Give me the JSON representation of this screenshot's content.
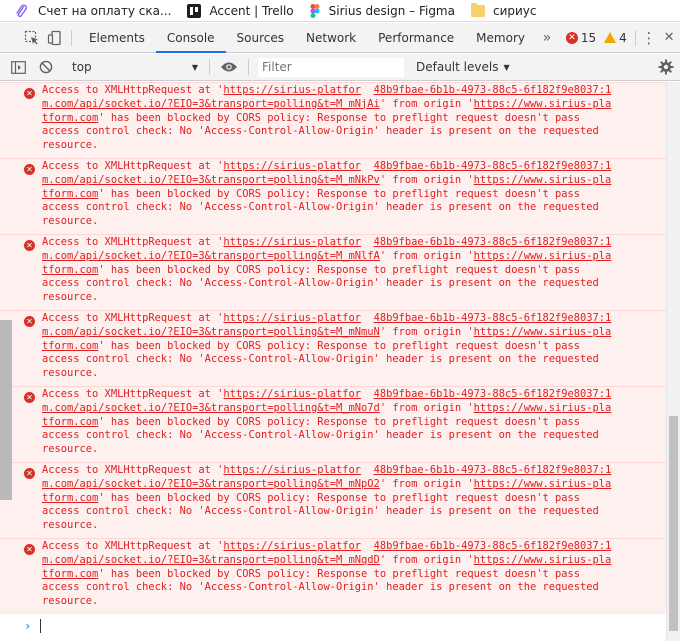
{
  "bookmarks": [
    {
      "label": "Счет на оплату ска...",
      "icon": "paperclip-icon"
    },
    {
      "label": "Accent | Trello",
      "icon": "trello-icon"
    },
    {
      "label": "Sirius design – Figma",
      "icon": "figma-icon"
    },
    {
      "label": "сириус",
      "icon": "folder-icon"
    }
  ],
  "devtools": {
    "tabs": [
      "Elements",
      "Console",
      "Sources",
      "Network",
      "Performance",
      "Memory"
    ],
    "active_tab": "Console",
    "more_label": "»",
    "errors_count": "15",
    "warnings_count": "4",
    "kebab_label": "⋮",
    "close_label": "✕"
  },
  "console_toolbar": {
    "context": "top",
    "filter_placeholder": "Filter",
    "levels_label": "Default levels"
  },
  "colors": {
    "error_text": "#e02020",
    "error_bg": "#fff0f0",
    "accent": "#1a73e8",
    "warning": "#f2a600"
  },
  "messages": [
    {
      "url_start": "https://sirius-platfor",
      "source": "48b9fbae-6b1b-4973-88c5-6f182f9e8037:1",
      "url_mid": "m.com/api/socket.io/?EIO=3&transport=polling&t=M_mNjAi",
      "origin_start": "https://www.sirius-pla",
      "origin_end": "tform.com"
    },
    {
      "url_start": "https://sirius-platfor",
      "source": "48b9fbae-6b1b-4973-88c5-6f182f9e8037:1",
      "url_mid": "m.com/api/socket.io/?EIO=3&transport=polling&t=M_mNkPv",
      "origin_start": "https://www.sirius-pla",
      "origin_end": "tform.com"
    },
    {
      "url_start": "https://sirius-platfor",
      "source": "48b9fbae-6b1b-4973-88c5-6f182f9e8037:1",
      "url_mid": "m.com/api/socket.io/?EIO=3&transport=polling&t=M_mNlfA",
      "origin_start": "https://www.sirius-pla",
      "origin_end": "tform.com"
    },
    {
      "url_start": "https://sirius-platfor",
      "source": "48b9fbae-6b1b-4973-88c5-6f182f9e8037:1",
      "url_mid": "m.com/api/socket.io/?EIO=3&transport=polling&t=M_mNmuN",
      "origin_start": "https://www.sirius-pla",
      "origin_end": "tform.com"
    },
    {
      "url_start": "https://sirius-platfor",
      "source": "48b9fbae-6b1b-4973-88c5-6f182f9e8037:1",
      "url_mid": "m.com/api/socket.io/?EIO=3&transport=polling&t=M_mNo7d",
      "origin_start": "https://www.sirius-pla",
      "origin_end": "tform.com"
    },
    {
      "url_start": "https://sirius-platfor",
      "source": "48b9fbae-6b1b-4973-88c5-6f182f9e8037:1",
      "url_mid": "m.com/api/socket.io/?EIO=3&transport=polling&t=M_mNpO2",
      "origin_start": "https://www.sirius-pla",
      "origin_end": "tform.com"
    },
    {
      "url_start": "https://sirius-platfor",
      "source": "48b9fbae-6b1b-4973-88c5-6f182f9e8037:1",
      "url_mid": "m.com/api/socket.io/?EIO=3&transport=polling&t=M_mNqdD",
      "origin_start": "https://www.sirius-pla",
      "origin_end": "tform.com"
    }
  ],
  "message_text": {
    "prefix": "Access to XMLHttpRequest at '",
    "from_origin": "' from origin '",
    "blocked": "' has been blocked by CORS policy: Response to preflight request doesn't pass",
    "line3": "access control check: No 'Access-Control-Allow-Origin' header is present on the requested",
    "line4": "resource."
  },
  "prompt": {
    "caret": "›"
  }
}
